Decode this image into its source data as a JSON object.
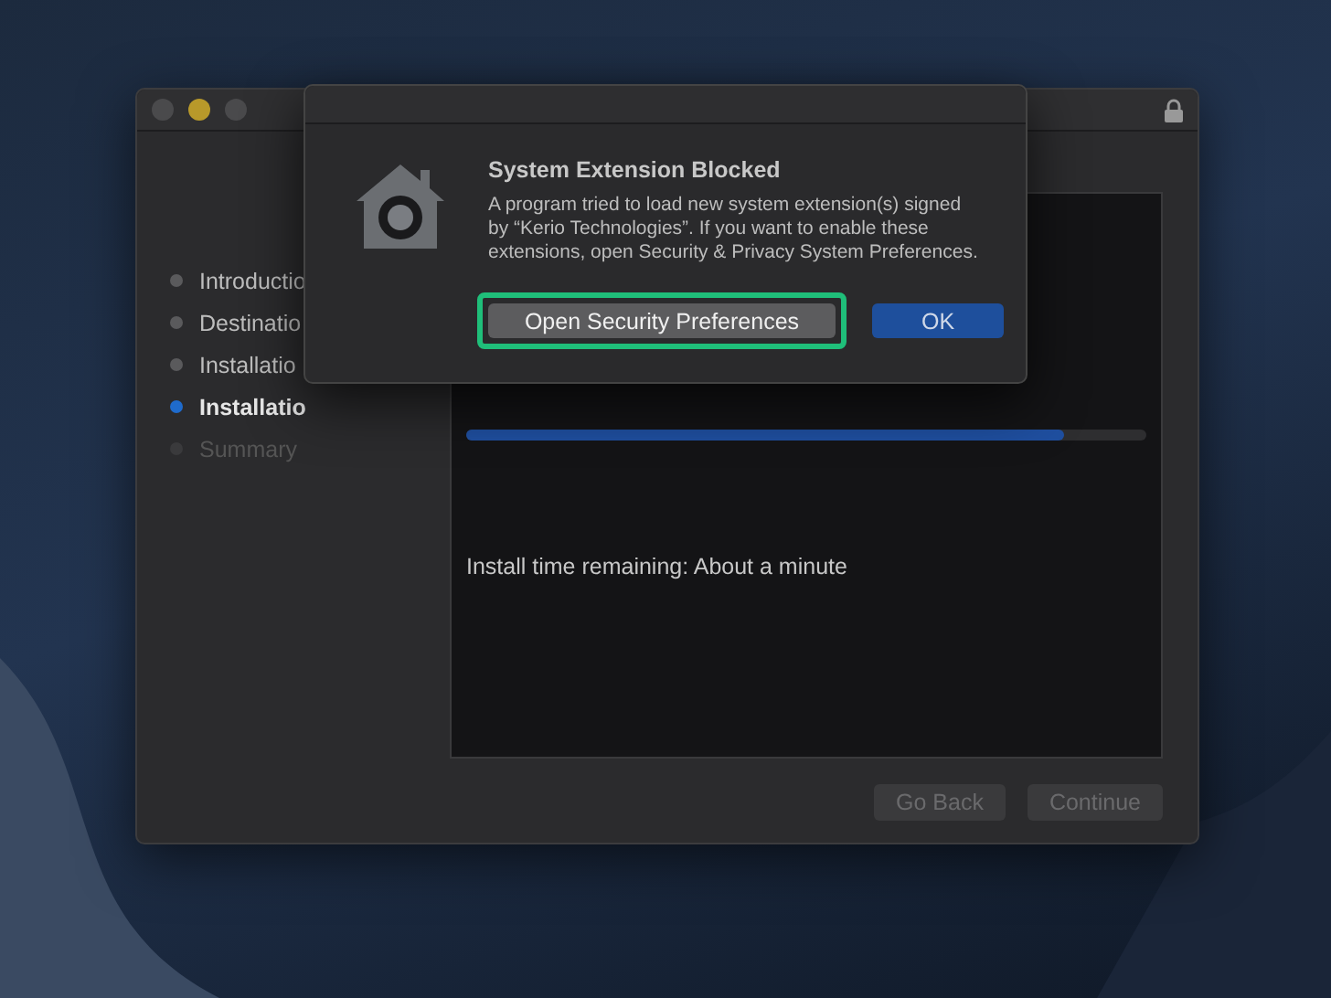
{
  "installer": {
    "steps": [
      {
        "label": "Introductio",
        "done": true,
        "current": false
      },
      {
        "label": "Destinatio",
        "done": true,
        "current": false
      },
      {
        "label": "Installatio",
        "done": true,
        "current": false
      },
      {
        "label": "Installatio",
        "done": false,
        "current": true
      },
      {
        "label": "Summary",
        "done": false,
        "current": false
      }
    ],
    "progress": {
      "level": 0.88
    },
    "status_text": "Install time remaining: About a minute",
    "buttons": [
      {
        "label": "Go Back",
        "disabled": true
      },
      {
        "label": "Continue",
        "disabled": true
      }
    ]
  },
  "dialog": {
    "title": "System Extension Blocked",
    "message": "A program tried to load new system extension(s) signed by “Kerio Technologies”.  If you want to enable these extensions, open Security & Privacy System Preferences.",
    "buttons": [
      {
        "label": "Open Security Preferences",
        "kind": "secondary",
        "highlighted": true
      },
      {
        "label": "OK",
        "kind": "default",
        "highlighted": false
      }
    ]
  }
}
